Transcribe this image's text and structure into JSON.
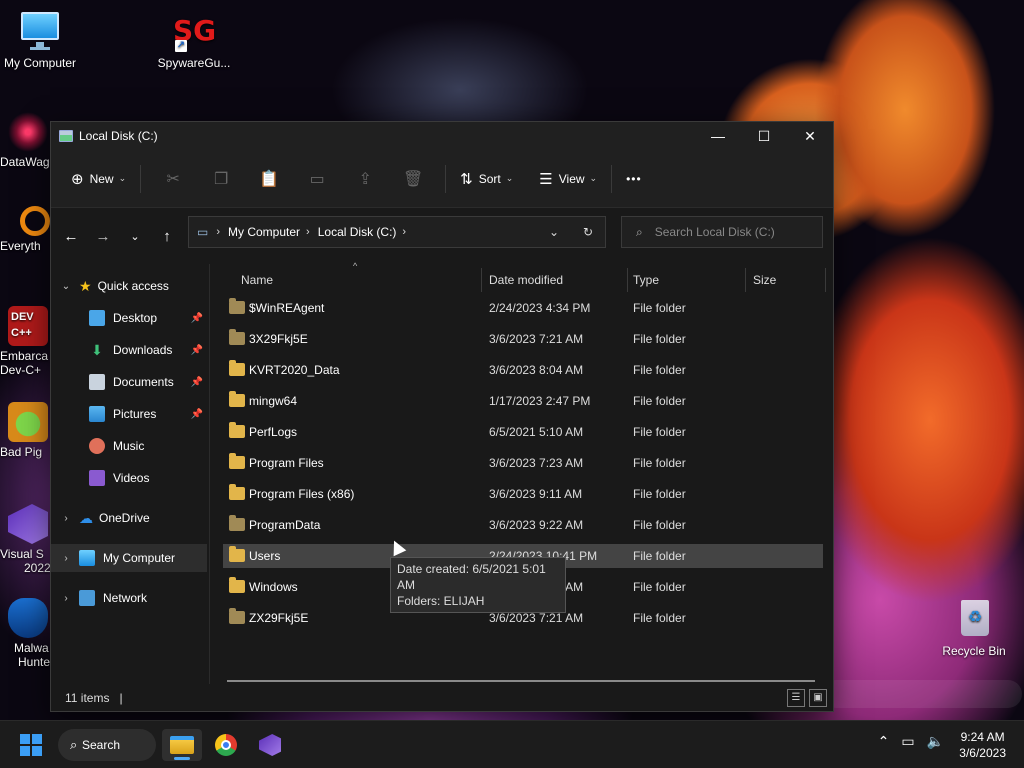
{
  "desktop": {
    "icons": [
      {
        "label": "My Computer"
      },
      {
        "label": "SpywareGu...",
        "glyph": "SG"
      }
    ],
    "partial_icons": [
      {
        "label": "DataWag"
      },
      {
        "label": "Everyth"
      },
      {
        "label": "Embarca",
        "label2": "Dev-C+",
        "glyph": "DEV C++"
      },
      {
        "label": "Bad Pig"
      },
      {
        "label": "Visual S",
        "label2": "2022"
      },
      {
        "label": "Malwa",
        "label2": "Hunte"
      }
    ],
    "recycle_bin": "Recycle Bin"
  },
  "window": {
    "title": "Local Disk (C:)",
    "controls": {
      "minimize": "—",
      "maximize": "☐",
      "close": "✕"
    },
    "toolbar": {
      "new_label": "New",
      "sort_label": "Sort",
      "view_label": "View",
      "more_label": "•••"
    },
    "address": {
      "segments": [
        "My Computer",
        "Local Disk (C:)"
      ]
    },
    "search_placeholder": "Search Local Disk (C:)",
    "nav": {
      "quick_access": "Quick access",
      "items": [
        {
          "label": "Desktop"
        },
        {
          "label": "Downloads"
        },
        {
          "label": "Documents"
        },
        {
          "label": "Pictures"
        },
        {
          "label": "Music"
        },
        {
          "label": "Videos"
        }
      ],
      "onedrive": "OneDrive",
      "my_computer": "My Computer",
      "network": "Network"
    },
    "columns": {
      "name": "Name",
      "date": "Date modified",
      "type": "Type",
      "size": "Size"
    },
    "files": [
      {
        "name": "$WinREAgent",
        "date": "2/24/2023 4:34 PM",
        "type": "File folder"
      },
      {
        "name": "3X29Fkj5E",
        "date": "3/6/2023 7:21 AM",
        "type": "File folder"
      },
      {
        "name": "KVRT2020_Data",
        "date": "3/6/2023 8:04 AM",
        "type": "File folder"
      },
      {
        "name": "mingw64",
        "date": "1/17/2023 2:47 PM",
        "type": "File folder"
      },
      {
        "name": "PerfLogs",
        "date": "6/5/2021 5:10 AM",
        "type": "File folder"
      },
      {
        "name": "Program Files",
        "date": "3/6/2023 7:23 AM",
        "type": "File folder"
      },
      {
        "name": "Program Files (x86)",
        "date": "3/6/2023 9:11 AM",
        "type": "File folder"
      },
      {
        "name": "ProgramData",
        "date": "3/6/2023 9:22 AM",
        "type": "File folder"
      },
      {
        "name": "Users",
        "date": "2/24/2023 10:41 PM",
        "type": "File folder"
      },
      {
        "name": "Windows",
        "date": "3/6/2023 9:17 AM",
        "type": "File folder"
      },
      {
        "name": "ZX29Fkj5E",
        "date": "3/6/2023 7:21 AM",
        "type": "File folder"
      }
    ],
    "tooltip": {
      "line1": "Date created: 6/5/2021 5:01 AM",
      "line2": "Folders: ELIJAH"
    },
    "status": "11 items"
  },
  "taskbar": {
    "search_label": "Search",
    "time": "9:24 AM",
    "date": "3/6/2023"
  },
  "colors": {
    "accent": "#4fa8f5",
    "folder": "#e2b54a",
    "window_bg": "#191919"
  }
}
